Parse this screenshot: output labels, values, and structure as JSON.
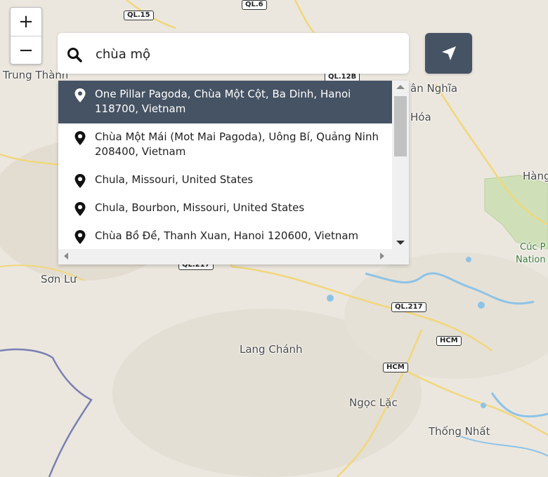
{
  "zoom": {
    "in_label": "+",
    "out_label": "−"
  },
  "search": {
    "value": "chùa mộ",
    "placeholder": ""
  },
  "suggestions": [
    "One Pillar Pagoda, Chùa Một Cột, Ba Dinh, Hanoi 118700, Vietnam",
    "Chùa Một Mái (Mot Mai Pagoda), Uông Bí, Quảng Ninh 208400, Vietnam",
    "Chula, Missouri, United States",
    "Chula, Bourbon, Missouri, United States",
    "Chùa Bồ Đề, Thanh Xuan, Hanoi 120600, Vietnam"
  ],
  "map": {
    "places": {
      "trung_thanh": "Trung Thành",
      "an_nghia": "ân Nghĩa",
      "hoa": "Hóa",
      "hang": "Hàng",
      "cuc_p": "Cúc P",
      "nation": "Nation",
      "son_lu": "Sơn Lư",
      "lang_chanh": "Lang Chánh",
      "ngoc_lac": "Ngọc Lặc",
      "thong_nhat": "Thống Nhất"
    },
    "shields": {
      "ql15": "QL.15",
      "ql6": "QL.6",
      "ql12b": "QL.12B",
      "ql217a": "QL.217",
      "ql217b": "QL.217",
      "hcm1": "HCM",
      "hcm2": "HCM"
    }
  },
  "colors": {
    "accent": "#465364",
    "map_bg": "#ebe7df",
    "water": "#8ec3e6",
    "park": "#cfe0b9"
  }
}
